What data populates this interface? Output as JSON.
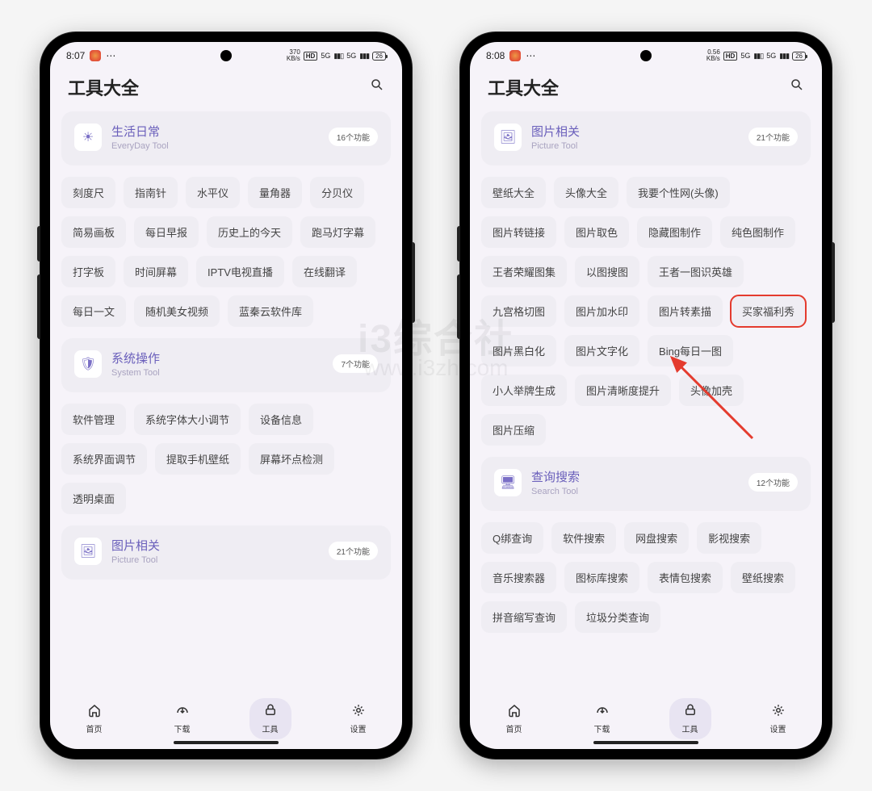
{
  "watermark_top": "i3综合社",
  "watermark_bottom": "www.i3zh.com",
  "nav": {
    "home": "首页",
    "download": "下载",
    "tools": "工具",
    "settings": "设置"
  },
  "left": {
    "status": {
      "time": "8:07",
      "kbps": "370\nKB/s",
      "hd": "HD",
      "net1": "5G",
      "net2": "5G",
      "batt": "26"
    },
    "title": "工具大全",
    "sections": [
      {
        "icon": "☀",
        "title": "生活日常",
        "sub": "EveryDay Tool",
        "count": "16个功能"
      },
      {
        "icon": "🛡",
        "title": "系统操作",
        "sub": "System Tool",
        "count": "7个功能"
      },
      {
        "icon": "🖼",
        "title": "图片相关",
        "sub": "Picture Tool",
        "count": "21个功能"
      }
    ],
    "chips1": [
      "刻度尺",
      "指南针",
      "水平仪",
      "量角器",
      "分贝仪",
      "简易画板",
      "每日早报",
      "历史上的今天",
      "跑马灯字幕",
      "打字板",
      "时间屏幕",
      "IPTV电视直播",
      "在线翻译",
      "每日一文",
      "随机美女视频",
      "蓝秦云软件库"
    ],
    "chips2": [
      "软件管理",
      "系统字体大小调节",
      "设备信息",
      "系统界面调节",
      "提取手机壁纸",
      "屏幕坏点检测",
      "透明桌面"
    ]
  },
  "right": {
    "status": {
      "time": "8:08",
      "kbps": "0.56\nKB/s",
      "hd": "HD",
      "net1": "5G",
      "net2": "5G",
      "batt": "26"
    },
    "title": "工具大全",
    "sections": [
      {
        "icon": "🖼",
        "title": "图片相关",
        "sub": "Picture Tool",
        "count": "21个功能"
      },
      {
        "icon": "🖥",
        "title": "查询搜索",
        "sub": "Search Tool",
        "count": "12个功能"
      }
    ],
    "chips1": [
      "壁纸大全",
      "头像大全",
      "我要个性网(头像)",
      "图片转链接",
      "图片取色",
      "隐藏图制作",
      "纯色图制作",
      "王者荣耀图集",
      "以图搜图",
      "王者一图识英雄",
      "九宫格切图",
      "图片加水印",
      "图片转素描",
      "买家福利秀",
      "图片黑白化",
      "图片文字化",
      "Bing每日一图",
      "小人举牌生成",
      "图片清晰度提升",
      "头像加壳",
      "图片压缩"
    ],
    "chips2": [
      "Q绑查询",
      "软件搜索",
      "网盘搜索",
      "影视搜索",
      "音乐搜索器",
      "图标库搜索",
      "表情包搜索",
      "壁纸搜索",
      "拼音缩写查询",
      "垃圾分类查询"
    ],
    "highlight": "买家福利秀"
  }
}
